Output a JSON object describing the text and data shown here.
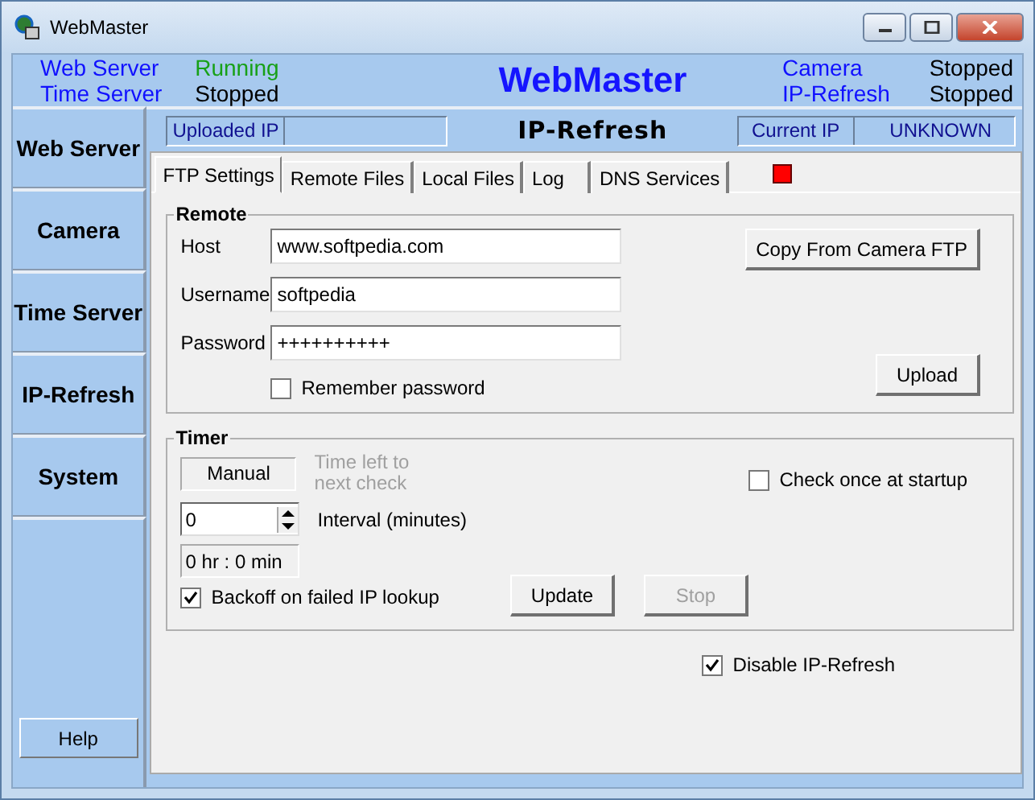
{
  "window": {
    "title": "WebMaster"
  },
  "header": {
    "title": "WebMaster",
    "services": [
      {
        "name": "Web Server",
        "status": "Running",
        "running": true
      },
      {
        "name": "Time Server",
        "status": "Stopped",
        "running": false
      },
      {
        "name": "Camera",
        "status": "Stopped",
        "running": false
      },
      {
        "name": "IP-Refresh",
        "status": "Stopped",
        "running": false
      }
    ]
  },
  "sidebar": {
    "items": [
      {
        "label": "Web Server"
      },
      {
        "label": "Camera"
      },
      {
        "label": "Time Server"
      },
      {
        "label": "IP-Refresh"
      },
      {
        "label": "System"
      }
    ],
    "help_button": "Help"
  },
  "ip_bar": {
    "uploaded_label": "Uploaded IP",
    "title": "IP-Refresh",
    "current_label": "Current IP",
    "current_value": "UNKNOWN"
  },
  "tabs": [
    {
      "label": "FTP Settings",
      "selected": true
    },
    {
      "label": "Remote Files",
      "selected": false
    },
    {
      "label": "Local Files",
      "selected": false
    },
    {
      "label": "Log",
      "selected": false
    },
    {
      "label": "DNS Services",
      "selected": false
    }
  ],
  "indicator": {
    "color": "#ff0000"
  },
  "remote": {
    "title": "Remote",
    "fields": [
      {
        "label": "Host",
        "value": "www.softpedia.com"
      },
      {
        "label": "Username",
        "value": "softpedia"
      },
      {
        "label": "Password",
        "value": "++++++++++"
      }
    ],
    "remember_password": {
      "label": "Remember password",
      "checked": false
    },
    "copy_button": "Copy From Camera FTP",
    "upload_button": "Upload"
  },
  "timer": {
    "title": "Timer",
    "mode": "Manual",
    "time_left_label": "Time left to next check",
    "time_left_disabled": true,
    "interval_value": "0",
    "interval_label": "Interval (minutes)",
    "remaining": "0 hr : 0 min",
    "backoff": {
      "label": "Backoff on failed IP lookup",
      "checked": true
    },
    "check_once": {
      "label": "Check once at startup",
      "checked": false
    },
    "buttons": [
      {
        "label": "Update",
        "disabled": false
      },
      {
        "label": "Stop",
        "disabled": true
      }
    ]
  },
  "disable_refresh": {
    "label": "Disable IP-Refresh",
    "checked": true
  }
}
